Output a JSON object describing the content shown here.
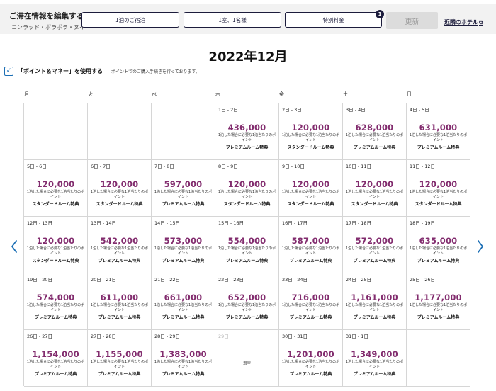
{
  "stay": {
    "title": "ご滞在情報を編集する",
    "hotel": "コンラッド・ボラボラ・ヌイ"
  },
  "fields": {
    "nights": "1泊のご宿泊",
    "guests": "1室、1名様",
    "rate": "特別料金",
    "rate_badge": "1"
  },
  "update_label": "更新",
  "nearby_label": "近隣のホテル",
  "month_title": "2022年12月",
  "points_toggle": {
    "label": "「ポイント＆マネー」を使用する",
    "note": "ポイントでのご購入手続きを行っております。",
    "checked": true
  },
  "weekdays": [
    "月",
    "火",
    "水",
    "木",
    "金",
    "土",
    "日"
  ],
  "price_note": "1泊した場合に必要な1泊当たりのポイント",
  "room_types": {
    "standard": "スタンダードルーム特典",
    "premium": "プレミアムルーム特典"
  },
  "sold_out_label": "満室",
  "days": [
    {
      "range": "",
      "points": "",
      "room": ""
    },
    {
      "range": "",
      "points": "",
      "room": ""
    },
    {
      "range": "",
      "points": "",
      "room": ""
    },
    {
      "range": "1日 - 2日",
      "points": "436,000",
      "room": "premium"
    },
    {
      "range": "2日 - 3日",
      "points": "120,000",
      "room": "standard"
    },
    {
      "range": "3日 - 4日",
      "points": "628,000",
      "room": "premium"
    },
    {
      "range": "4日 - 5日",
      "points": "631,000",
      "room": "premium"
    },
    {
      "range": "5日 - 6日",
      "points": "120,000",
      "room": "standard"
    },
    {
      "range": "6日 - 7日",
      "points": "120,000",
      "room": "standard"
    },
    {
      "range": "7日 - 8日",
      "points": "597,000",
      "room": "premium"
    },
    {
      "range": "8日 - 9日",
      "points": "120,000",
      "room": "standard"
    },
    {
      "range": "9日 - 10日",
      "points": "120,000",
      "room": "standard"
    },
    {
      "range": "10日 - 11日",
      "points": "120,000",
      "room": "standard"
    },
    {
      "range": "11日 - 12日",
      "points": "120,000",
      "room": "standard"
    },
    {
      "range": "12日 - 13日",
      "points": "120,000",
      "room": "standard"
    },
    {
      "range": "13日 - 14日",
      "points": "542,000",
      "room": "premium"
    },
    {
      "range": "14日 - 15日",
      "points": "573,000",
      "room": "premium"
    },
    {
      "range": "15日 - 16日",
      "points": "554,000",
      "room": "premium"
    },
    {
      "range": "16日 - 17日",
      "points": "587,000",
      "room": "premium"
    },
    {
      "range": "17日 - 18日",
      "points": "572,000",
      "room": "premium"
    },
    {
      "range": "18日 - 19日",
      "points": "635,000",
      "room": "premium"
    },
    {
      "range": "19日 - 20日",
      "points": "574,000",
      "room": "premium"
    },
    {
      "range": "20日 - 21日",
      "points": "611,000",
      "room": "premium"
    },
    {
      "range": "21日 - 22日",
      "points": "661,000",
      "room": "premium"
    },
    {
      "range": "22日 - 23日",
      "points": "652,000",
      "room": "premium"
    },
    {
      "range": "23日 - 24日",
      "points": "716,000",
      "room": "premium"
    },
    {
      "range": "24日 - 25日",
      "points": "1,161,000",
      "room": "premium"
    },
    {
      "range": "25日 - 26日",
      "points": "1,177,000",
      "room": "premium"
    },
    {
      "range": "26日 - 27日",
      "points": "1,154,000",
      "room": "premium"
    },
    {
      "range": "27日 - 28日",
      "points": "1,155,000",
      "room": "premium"
    },
    {
      "range": "28日 - 29日",
      "points": "1,383,000",
      "room": "premium"
    },
    {
      "range": "29日",
      "points": "",
      "room": "",
      "sold_out": true
    },
    {
      "range": "30日 - 31日",
      "points": "1,201,000",
      "room": "premium"
    },
    {
      "range": "31日 - 1日",
      "points": "1,349,000",
      "room": "premium"
    },
    {
      "range": "",
      "points": "",
      "room": ""
    }
  ],
  "colors": {
    "points": "#822c6e",
    "navy": "#1c1c3c",
    "link_blue": "#1c6fb5"
  },
  "icons": {
    "prev": "chevron-left-icon",
    "next": "chevron-right-icon",
    "external": "external-link-icon",
    "check": "checkmark-icon"
  }
}
